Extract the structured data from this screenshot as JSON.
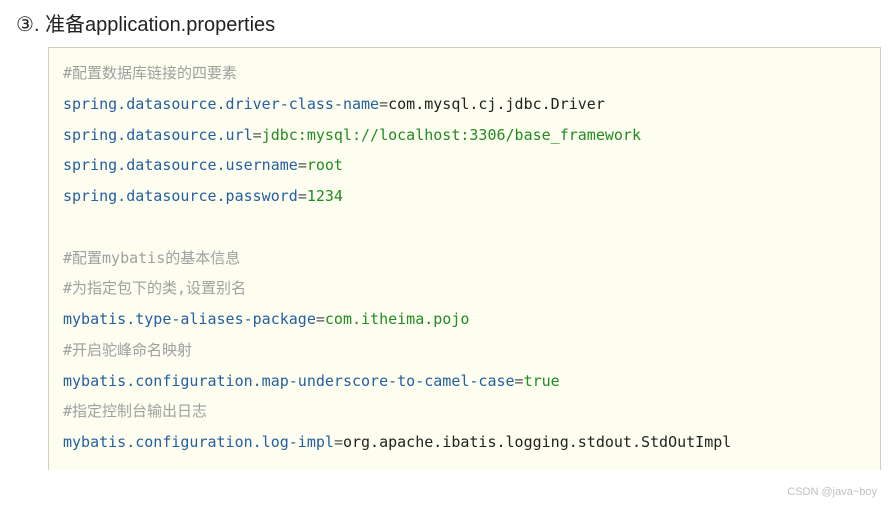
{
  "heading": {
    "num_icon": "③",
    "dot": ".",
    "title": "准备application.properties"
  },
  "lines": {
    "c1": "#配置数据库链接的四要素",
    "k1": "spring.datasource.driver-class-name",
    "v1": "com.mysql.cj.jdbc.Driver",
    "k2": "spring.datasource.url",
    "v2": "jdbc:mysql://localhost:3306/base_framework",
    "k3": "spring.datasource.username",
    "v3": "root",
    "k4": "spring.datasource.password",
    "v4": "1234",
    "c2": "#配置mybatis的基本信息",
    "c3": "#为指定包下的类,设置别名",
    "k5": "mybatis.type-aliases-package",
    "v5": "com.itheima.pojo",
    "c4": "#开启驼峰命名映射",
    "k6": "mybatis.configuration.map-underscore-to-camel-case",
    "v6": "true",
    "c5": "#指定控制台输出日志",
    "k7": "mybatis.configuration.log-impl",
    "v7": "org.apache.ibatis.logging.stdout.StdOutImpl"
  },
  "eq": "=",
  "watermark": "CSDN @java~boy"
}
